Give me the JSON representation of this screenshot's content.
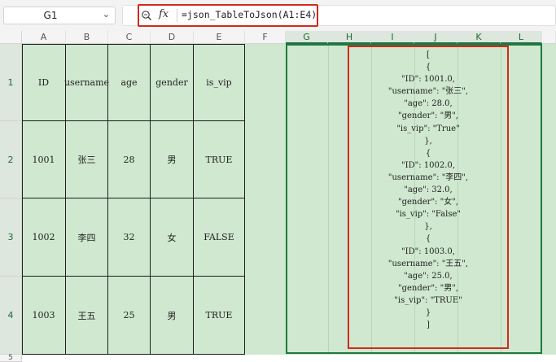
{
  "formula_bar": {
    "name_box": "G1",
    "fx_label": "fx",
    "formula": "=json_TableToJson(A1:E4)"
  },
  "columns": [
    "A",
    "B",
    "C",
    "D",
    "E",
    "F",
    "G",
    "H",
    "I",
    "J",
    "K",
    "L"
  ],
  "rows": [
    "1",
    "2",
    "3",
    "4",
    "5"
  ],
  "table": [
    [
      "ID",
      "username",
      "age",
      "gender",
      "is_vip"
    ],
    [
      "1001",
      "张三",
      "28",
      "男",
      "TRUE"
    ],
    [
      "1002",
      "李四",
      "32",
      "女",
      "FALSE"
    ],
    [
      "1003",
      "王五",
      "25",
      "男",
      "TRUE"
    ]
  ],
  "json_output": [
    "[",
    "{",
    "\"ID\": 1001.0,",
    "\"username\": \"张三\",",
    "\"age\": 28.0,",
    "\"gender\": \"男\",",
    "\"is_vip\": \"True\"",
    "},",
    "{",
    "\"ID\": 1002.0,",
    "\"username\": \"李四\",",
    "\"age\": 32.0,",
    "\"gender\": \"女\",",
    "\"is_vip\": \"False\"",
    "},",
    "{",
    "\"ID\": 1003.0,",
    "\"username\": \"王五\",",
    "\"age\": 25.0,",
    "\"gender\": \"男\",",
    "\"is_vip\": \"TRUE\"",
    "}",
    "]"
  ],
  "colors": {
    "cell_fill": "#cfe8cf",
    "highlight_red": "#d6281c",
    "selection_green": "#1e7a3e"
  }
}
